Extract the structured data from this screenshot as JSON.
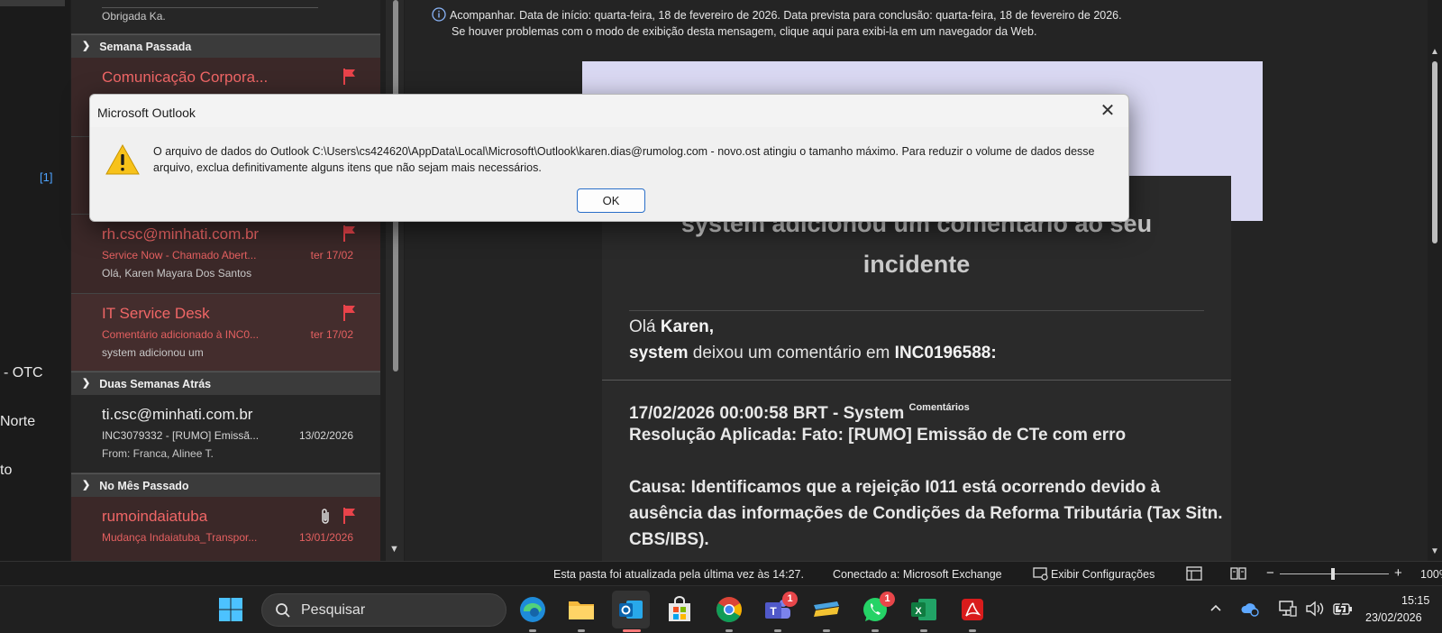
{
  "folders": {
    "items": [
      {
        "label": "[1]"
      },
      {
        "label": "- OTC"
      },
      {
        "label": "Norte"
      },
      {
        "label": "to"
      }
    ]
  },
  "message_list": {
    "top_partial": {
      "preview": "Obrigada Ka."
    },
    "groups": [
      {
        "label": "Semana Passada"
      },
      {
        "label": "Duas Semanas Atrás"
      },
      {
        "label": "No Mês Passado"
      }
    ],
    "mails": [
      {
        "sender": "Comunicação Corpora...",
        "subject": "",
        "date": "",
        "preview": ""
      },
      {
        "sender": "rh.csc@minhati.com.br",
        "subject": "Service Now - Chamado Abert...",
        "date": "ter 17/02",
        "preview": "Olá, Karen Mayara Dos Santos"
      },
      {
        "sender": "IT Service Desk",
        "subject": "Comentário adicionado à INC0...",
        "date": "ter 17/02",
        "preview": "system adicionou um"
      },
      {
        "sender": "ti.csc@minhati.com.br",
        "subject": "INC3079332 - [RUMO] Emissã...",
        "date": "13/02/2026",
        "preview": "From: Franca, Alinee T."
      },
      {
        "sender": "rumoindaiatuba",
        "subject": "Mudança Indaiatuba_Transpor...",
        "date": "13/01/2026",
        "preview": ""
      }
    ]
  },
  "reading_pane": {
    "info_line1": "Acompanhar.  Data de início: quarta-feira, 18 de fevereiro de 2026.  Data prevista para conclusão: quarta-feira, 18 de fevereiro de 2026.",
    "info_line2": "Se houver problemas com o modo de exibição desta mensagem, clique aqui para exibi-la em um navegador da Web.",
    "card_title_line1": "system adicionou um comentário ao seu",
    "card_title_line2": "incidente",
    "greeting_prefix": "Olá ",
    "greeting_name": "Karen,",
    "comment_user": "system",
    "comment_mid": " deixou um comentário em ",
    "comment_incident": "INC0196588:",
    "entry_header": "17/02/2026 00:00:58 BRT - System",
    "entry_sup": "Comentários",
    "resolution": "Resolução Aplicada: Fato: [RUMO] Emissão de CTe com erro",
    "cause_line1": "Causa: Identificamos que a rejeição I011 está ocorrendo devido à",
    "cause_line2": "ausência das informações de Condições da Reforma Tributária (Tax Sitn.",
    "cause_line3": "CBS/IBS)."
  },
  "status_bar": {
    "updated": "Esta pasta foi atualizada pela última vez às 14:27.",
    "connected": "Conectado a: Microsoft Exchange",
    "display_settings": "Exibir Configurações",
    "zoom_minus": "−",
    "zoom_plus": "+",
    "zoom_value": "100%",
    "zoom_fraction": 0.49
  },
  "taskbar": {
    "search_label": "Pesquisar",
    "teams_badge": "1",
    "whatsapp_badge": "1",
    "time": "15:15",
    "date": "23/02/2026"
  },
  "dialog": {
    "title": "Microsoft Outlook",
    "message": "O arquivo de dados do Outlook C:\\Users\\cs424620\\AppData\\Local\\Microsoft\\Outlook\\karen.dias@rumolog.com - novo.ost atingiu o tamanho máximo. Para reduzir o volume de dados desse arquivo, exclua definitivamente alguns itens que não sejam mais necessários.",
    "ok_label": "OK",
    "close_glyph": "✕"
  },
  "colors": {
    "flag_red": "#e8434a",
    "accent_blue": "#4ea3ff",
    "warning_yellow": "#f7c21a"
  }
}
